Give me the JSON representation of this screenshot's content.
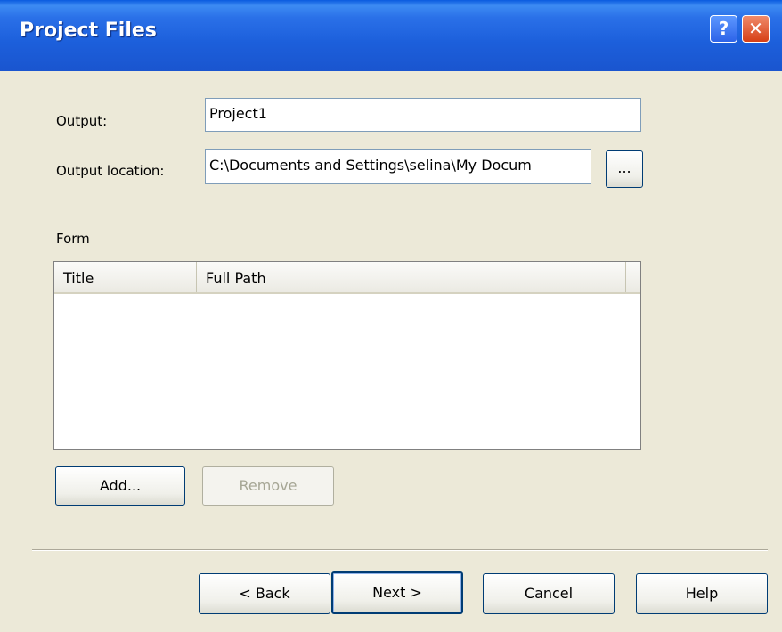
{
  "dialog": {
    "title": "Project Files"
  },
  "titlebar": {
    "help_glyph": "?",
    "close_glyph": "✕"
  },
  "form": {
    "output_label": "Output:",
    "output_value": "Project1",
    "location_label": "Output location:",
    "location_value": "C:\\Documents and Settings\\selina\\My Docum",
    "browse_label": "...",
    "group_label": "Form"
  },
  "list": {
    "columns": [
      "Title",
      "Full Path"
    ],
    "rows": []
  },
  "buttons": {
    "add": "Add...",
    "remove": "Remove",
    "back": "< Back",
    "next": "Next >",
    "cancel": "Cancel",
    "help": "Help"
  },
  "icons": {
    "help": "help-icon",
    "close": "close-icon"
  },
  "colors": {
    "titlebar": "#1c5fdb",
    "dialog_bg": "#ece9d8",
    "close_button": "#d63f16"
  }
}
